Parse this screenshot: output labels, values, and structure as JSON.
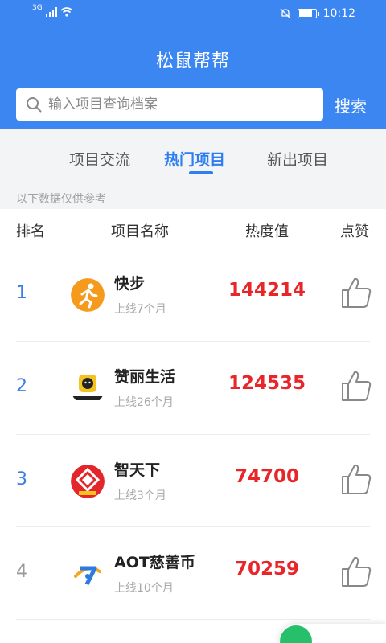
{
  "status_bar": {
    "network": "3G",
    "time": "10:12",
    "battery_level": 0.8
  },
  "app": {
    "title": "松鼠帮帮"
  },
  "search": {
    "placeholder": "输入项目查询档案",
    "button_label": "搜索"
  },
  "tabs": [
    {
      "label": "项目交流",
      "active": false
    },
    {
      "label": "热门项目",
      "active": true
    },
    {
      "label": "新出项目",
      "active": false
    }
  ],
  "notice": "以下数据仅供参考",
  "columns": {
    "rank": "排名",
    "name": "项目名称",
    "heat": "热度值",
    "like": "点赞"
  },
  "projects": [
    {
      "rank": "1",
      "name": "快步",
      "online": "上线7个月",
      "heat": "144214",
      "logo": "runner-logo"
    },
    {
      "rank": "2",
      "name": "赞丽生活",
      "online": "上线26个月",
      "heat": "124535",
      "logo": "zanli-logo"
    },
    {
      "rank": "3",
      "name": "智天下",
      "online": "上线3个月",
      "heat": "74700",
      "logo": "zhitianxia-logo"
    },
    {
      "rank": "4",
      "name": "AOT慈善币",
      "online": "上线10个月",
      "heat": "70259",
      "logo": "aot-logo"
    }
  ],
  "colors": {
    "primary": "#3b86f0",
    "heat": "#e8262a",
    "rank": "#3b7ce6",
    "fab": "#27c06a"
  }
}
